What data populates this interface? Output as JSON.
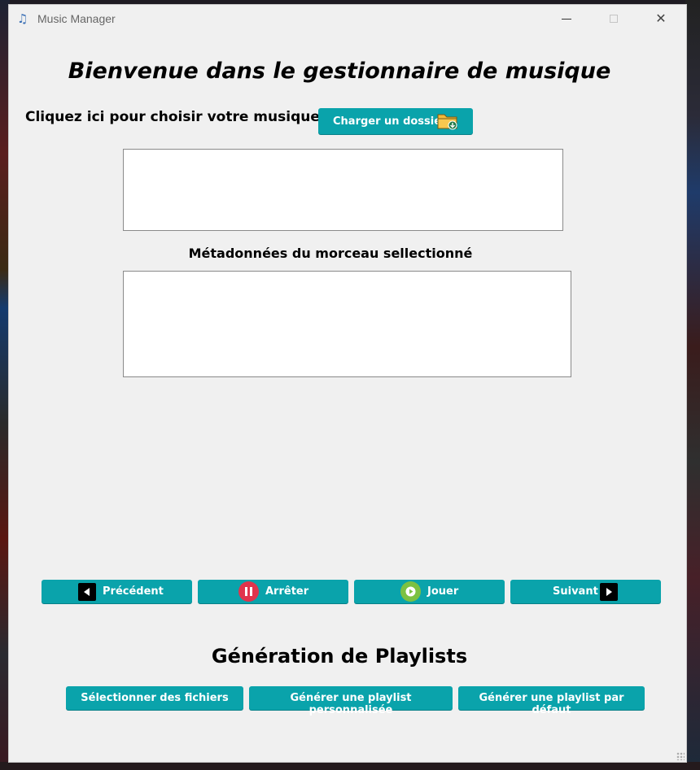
{
  "window": {
    "title": "Music Manager",
    "app_icon": "music-note-icon",
    "controls": [
      "minimize-icon",
      "maximize-icon",
      "close-icon"
    ],
    "close_glyph": "✕"
  },
  "main": {
    "title": "Bienvenue dans le gestionnaire de musique",
    "choose_label": "Cliquez ici pour choisir votre musique:",
    "load_button": "Charger un dossier",
    "metadata_label": "Métadonnées du morceau sellectionné"
  },
  "player": {
    "previous": "Précédent",
    "stop": "Arrêter",
    "play": "Jouer",
    "next": "Suivant"
  },
  "playlists": {
    "title": "Génération de Playlists",
    "select_files": "Sélectionner des fichiers",
    "custom": "Générer une playlist personnalisée",
    "default": "Générer une playlist par défaut"
  },
  "colors": {
    "accent": "#0aa3ab",
    "window_bg": "#f0f0f0",
    "stop_icon": "#e0344c",
    "play_icon": "#7cc142"
  }
}
